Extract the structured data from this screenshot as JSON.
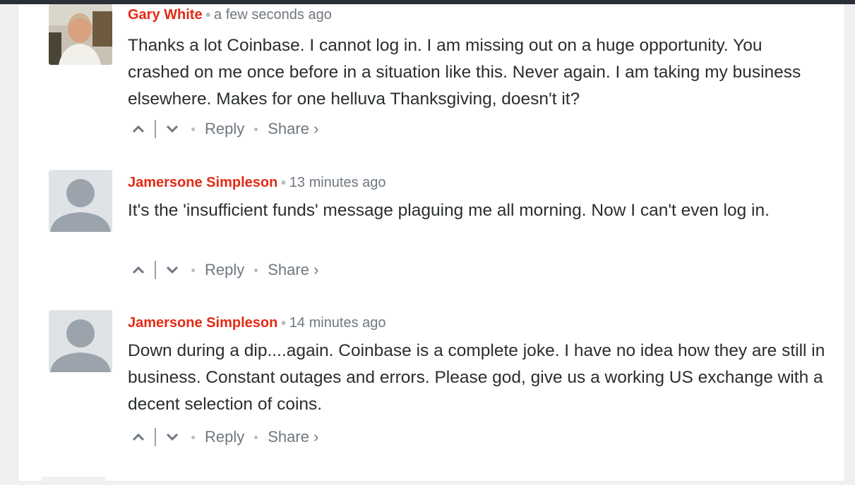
{
  "colors": {
    "author": "#e32a14",
    "meta": "#6f7780",
    "text": "#2a2e2e",
    "avatar_bg": "#dfe3e6",
    "avatar_fg": "#9ba4ad"
  },
  "comments": [
    {
      "author": "Gary White",
      "time": "a few seconds ago",
      "text": "Thanks a lot Coinbase. I cannot log in. I am missing out on a huge opportunity. You crashed on me once before in a situation like this. Never again. I am taking my business elsewhere. Makes for one helluva Thanksgiving, doesn't it?",
      "avatar": "photo",
      "reply": "Reply",
      "share": "Share ›"
    },
    {
      "author": "Jamersone Simpleson",
      "time": "13 minutes ago",
      "text": "It's the 'insufficient funds' message plaguing me all morning. Now I can't even log in.",
      "avatar": "default-user-icon",
      "reply": "Reply",
      "share": "Share ›"
    },
    {
      "author": "Jamersone Simpleson",
      "time": "14 minutes ago",
      "text": "Down during a dip....again. Coinbase is a complete joke. I have no idea how they are still in business. Constant outages and errors. Please god, give us a working US exchange with a decent selection of coins.",
      "avatar": "default-user-icon",
      "reply": "Reply",
      "share": "Share ›"
    }
  ]
}
